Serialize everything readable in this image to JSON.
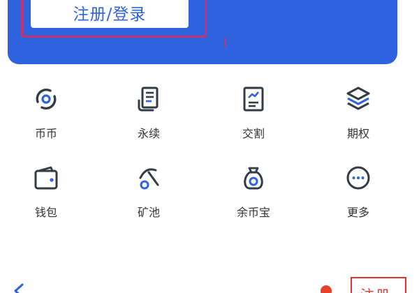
{
  "header": {
    "login_button_label": "注册/登录"
  },
  "shortcuts": [
    {
      "label": "币币",
      "icon": "coin-exchange-icon"
    },
    {
      "label": "永续",
      "icon": "perpetual-document-icon"
    },
    {
      "label": "交割",
      "icon": "delivery-chart-icon"
    },
    {
      "label": "期权",
      "icon": "options-layers-icon"
    },
    {
      "label": "钱包",
      "icon": "wallet-icon"
    },
    {
      "label": "矿池",
      "icon": "mining-pool-icon"
    },
    {
      "label": "余币宝",
      "icon": "money-bag-icon"
    },
    {
      "label": "更多",
      "icon": "more-dots-icon"
    }
  ],
  "footer": {
    "register_label": "注册"
  },
  "colors": {
    "brand_blue": "#2f62de",
    "icon_dark": "#333b45",
    "icon_accent": "#2f62de",
    "highlight": "#c8326e",
    "register_red": "#e0352b"
  }
}
